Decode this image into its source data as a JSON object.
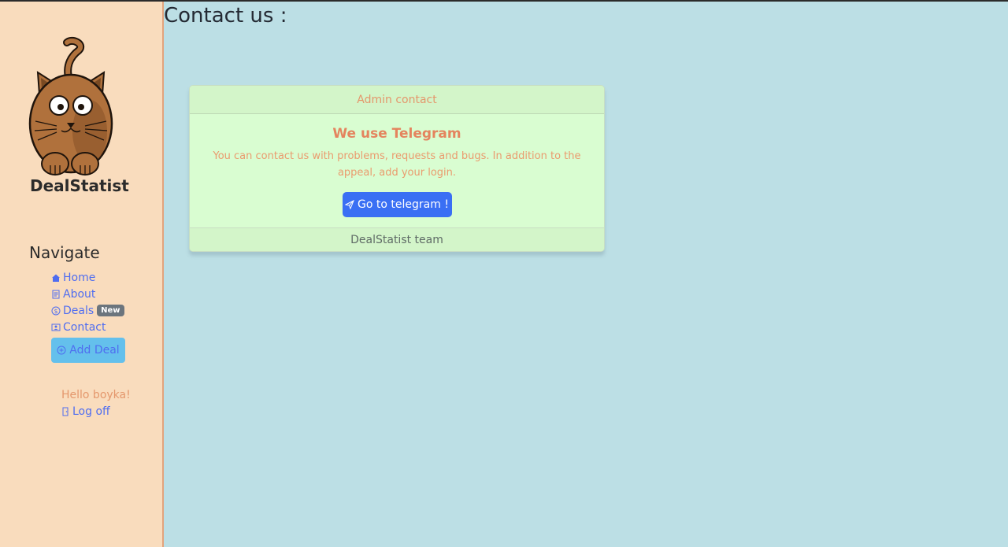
{
  "sidebar": {
    "brand": "DealStatist",
    "navigate_title": "Navigate",
    "items": [
      {
        "label": "Home",
        "icon": "house-icon"
      },
      {
        "label": "About",
        "icon": "document-icon"
      },
      {
        "label": "Deals",
        "icon": "dollar-circle-icon",
        "badge": "New"
      },
      {
        "label": "Contact",
        "icon": "person-card-icon"
      }
    ],
    "add_deal_label": "Add Deal",
    "greeting": "Hello boyka!",
    "logoff_label": "Log off"
  },
  "main": {
    "title": "Contact us :",
    "card": {
      "header": "Admin contact",
      "title": "We use Telegram",
      "text": "You can contact us with problems, requests and bugs. In addition to the appeal, add your login.",
      "button_label": "Go to telegram !",
      "footer": "DealStatist team"
    }
  },
  "colors": {
    "main_bg": "#bcdfe5",
    "sidebar_bg": "#f9dcbd",
    "link": "#4f6df0",
    "accent_text": "#e4976c",
    "button_primary": "#3a6ff4",
    "add_deal_bg": "#64c0ec",
    "card_bg": "#d9fdd1"
  }
}
